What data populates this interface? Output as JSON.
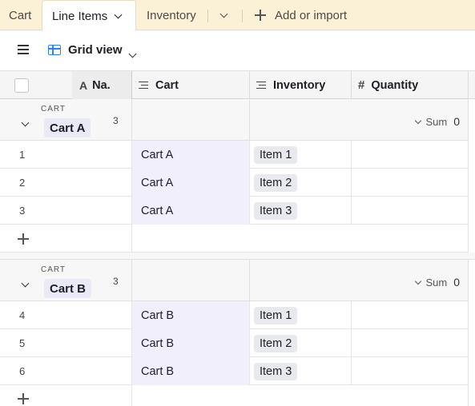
{
  "tabs": {
    "cart": "Cart",
    "line_items": "Line Items",
    "inventory": "Inventory",
    "add_or_import": "Add or import"
  },
  "view": {
    "name": "Grid view"
  },
  "columns": {
    "name": "Na.",
    "cart": "Cart",
    "inventory": "Inventory",
    "quantity": "Quantity"
  },
  "groups": [
    {
      "field": "CART",
      "value": "Cart A",
      "count": "3",
      "sum_label": "Sum",
      "sum_value": "0",
      "rows": [
        {
          "num": "1",
          "cart": "Cart A",
          "inventory": "Item 1"
        },
        {
          "num": "2",
          "cart": "Cart A",
          "inventory": "Item 2"
        },
        {
          "num": "3",
          "cart": "Cart A",
          "inventory": "Item 3"
        }
      ]
    },
    {
      "field": "CART",
      "value": "Cart B",
      "count": "3",
      "sum_label": "Sum",
      "sum_value": "0",
      "rows": [
        {
          "num": "4",
          "cart": "Cart B",
          "inventory": "Item 1"
        },
        {
          "num": "5",
          "cart": "Cart B",
          "inventory": "Item 2"
        },
        {
          "num": "6",
          "cart": "Cart B",
          "inventory": "Item 3"
        }
      ]
    }
  ],
  "colors": {
    "tabbar_bg": "#fbf1d6",
    "accent": "#2d7ff9",
    "cart_cell_bg": "#f1effc"
  }
}
